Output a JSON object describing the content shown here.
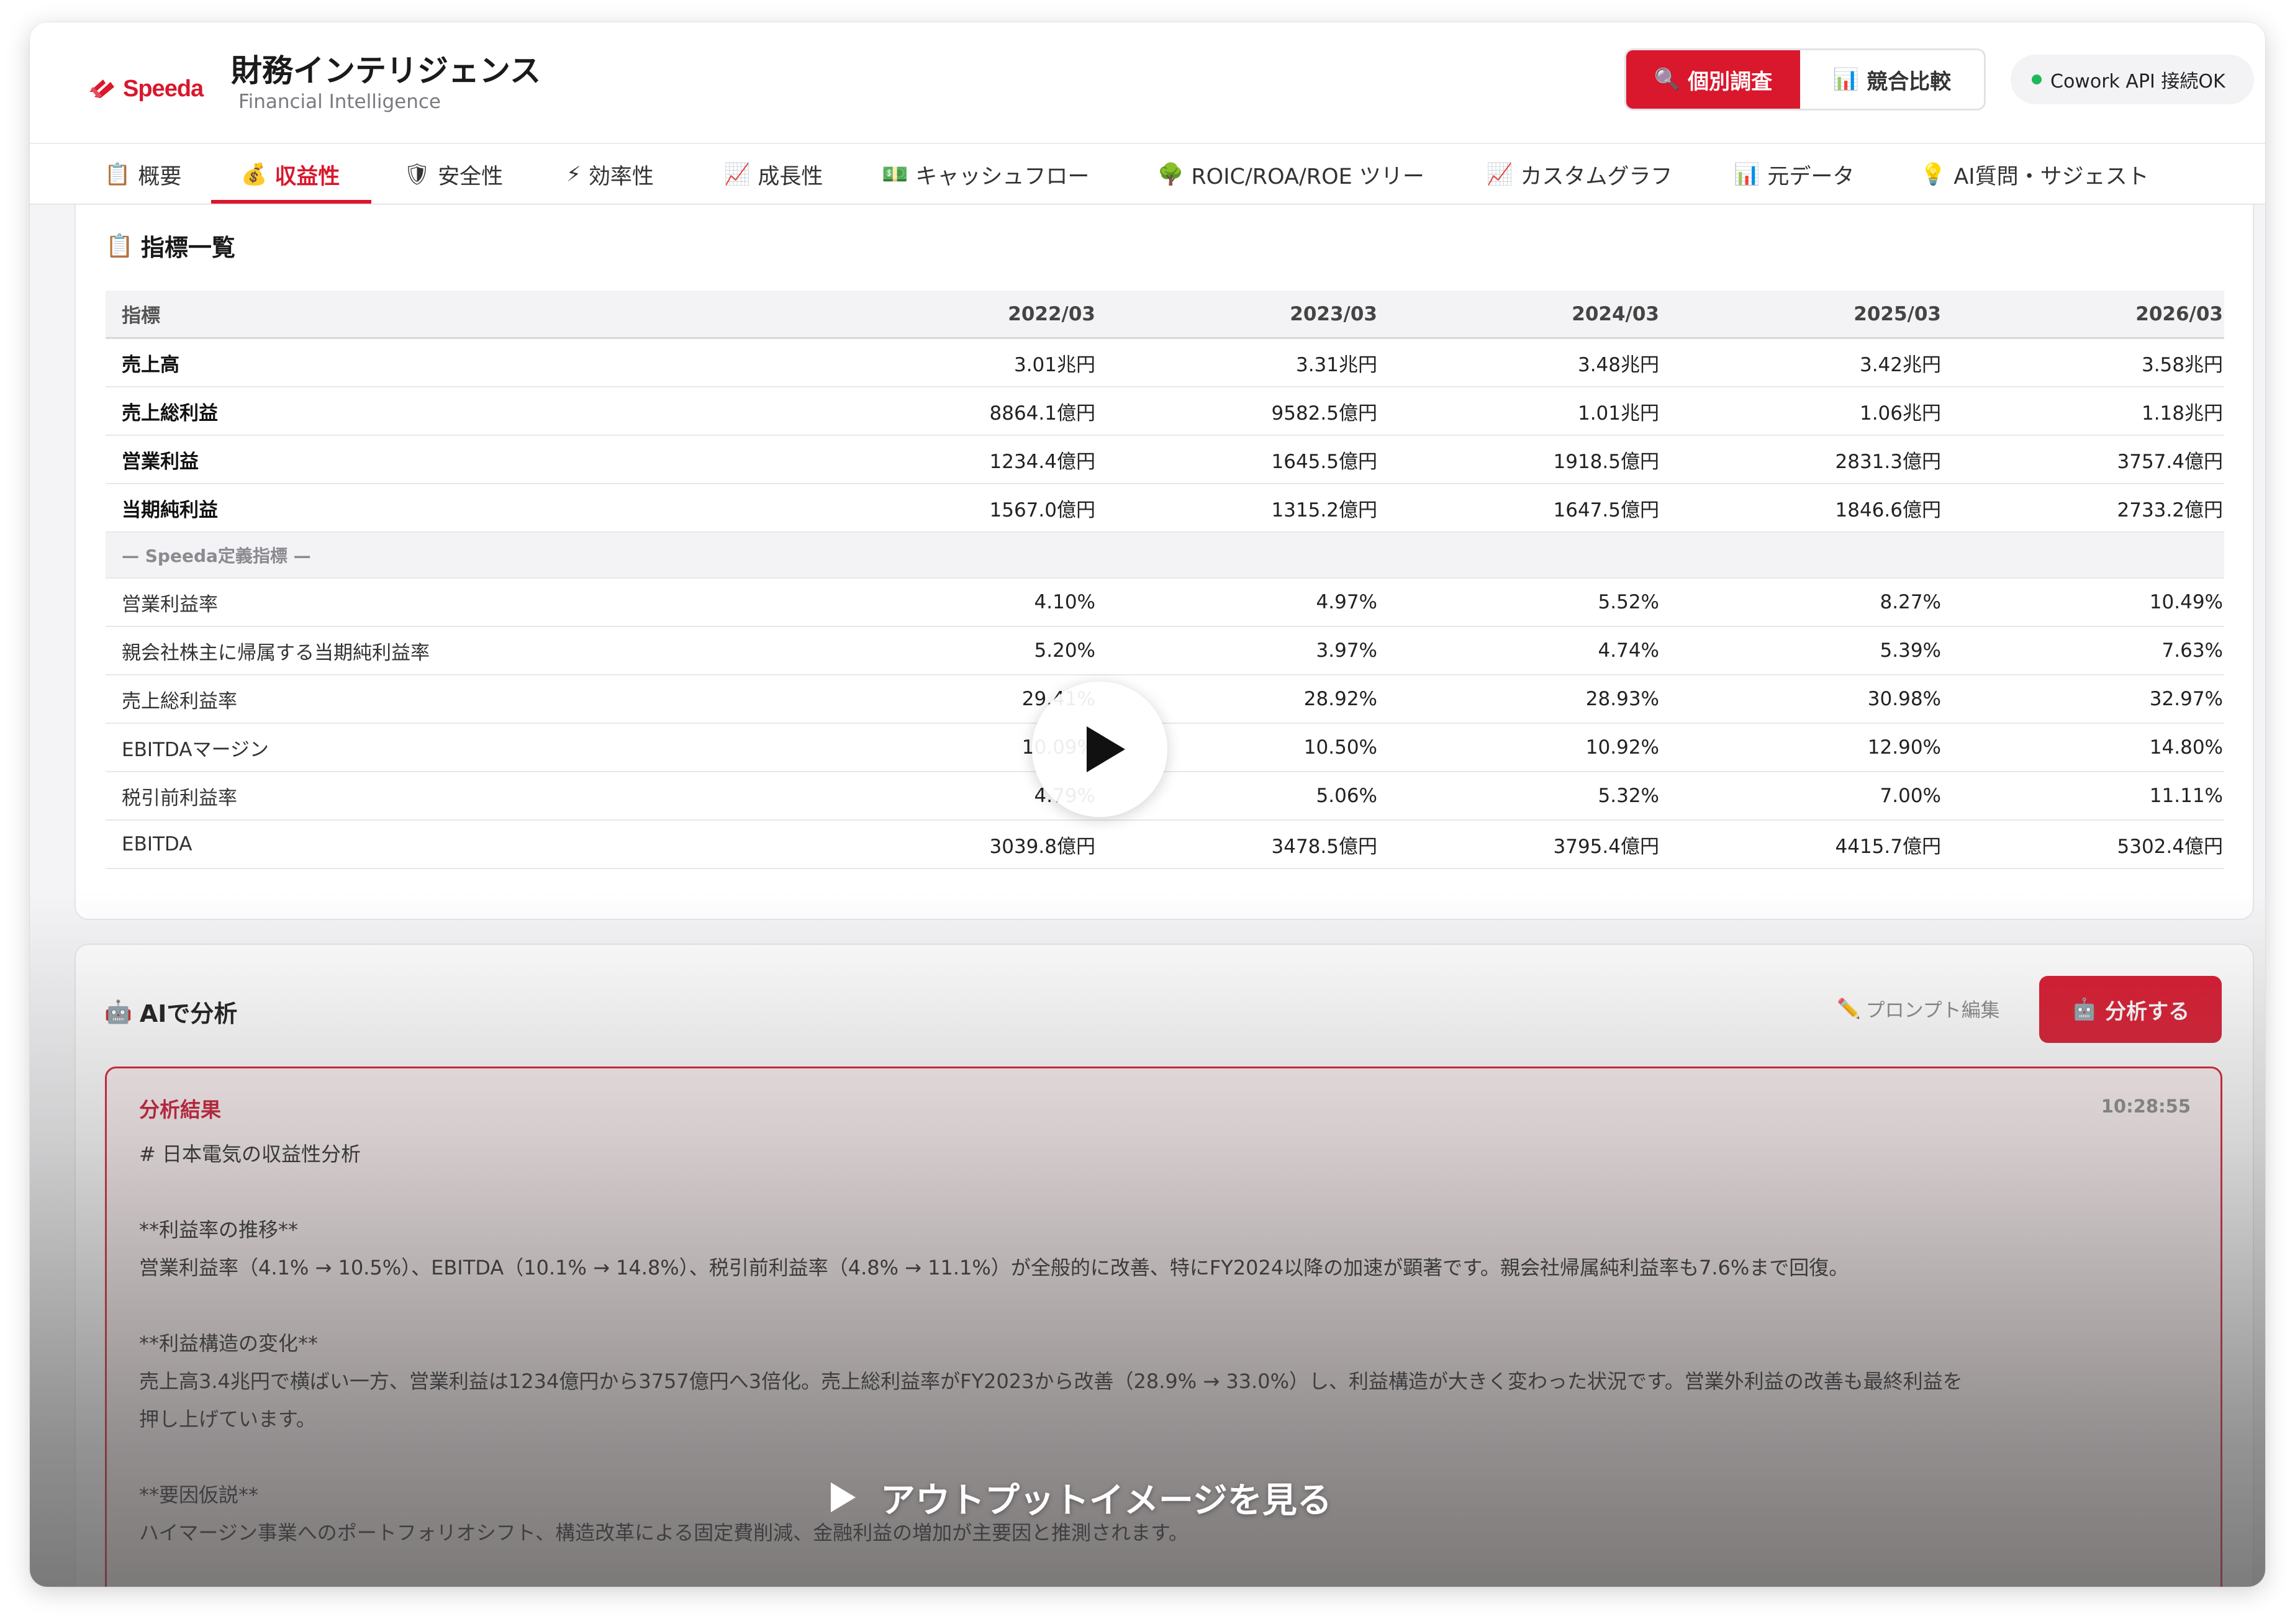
{
  "header": {
    "logo_text": "Speeda",
    "title": "財務インテリジェンス",
    "subtitle": "Financial Intelligence",
    "modes": [
      {
        "label": "個別調査",
        "icon": "search-icon",
        "active": true
      },
      {
        "label": "競合比較",
        "icon": "bar-chart-icon",
        "active": false
      }
    ],
    "status": "Cowork API 接続OK",
    "status_color": "#1fb85a"
  },
  "tabs": [
    {
      "label": "概要",
      "icon": "📋"
    },
    {
      "label": "収益性",
      "icon": "💰",
      "active": true
    },
    {
      "label": "安全性",
      "icon": "🛡"
    },
    {
      "label": "効率性",
      "icon": "⚡"
    },
    {
      "label": "成長性",
      "icon": "📈"
    },
    {
      "label": "キャッシュフロー",
      "icon": "💵"
    },
    {
      "label": "ROIC/ROA/ROE ツリー",
      "icon": "🌳"
    },
    {
      "label": "カスタムグラフ",
      "icon": "📈"
    },
    {
      "label": "元データ",
      "icon": "📊"
    },
    {
      "label": "AI質問・サジェスト",
      "icon": "💡"
    }
  ],
  "metrics": {
    "title": "指標一覧",
    "columns": [
      "指標",
      "2022/03",
      "2023/03",
      "2024/03",
      "2025/03",
      "2026/03"
    ],
    "rows": [
      {
        "label": "売上高",
        "values": [
          "3.01兆円",
          "3.31兆円",
          "3.48兆円",
          "3.42兆円",
          "3.58兆円"
        ],
        "bold": true
      },
      {
        "label": "売上総利益",
        "values": [
          "8864.1億円",
          "9582.5億円",
          "1.01兆円",
          "1.06兆円",
          "1.18兆円"
        ],
        "bold": true
      },
      {
        "label": "営業利益",
        "values": [
          "1234.4億円",
          "1645.5億円",
          "1918.5億円",
          "2831.3億円",
          "3757.4億円"
        ],
        "bold": true
      },
      {
        "label": "当期純利益",
        "values": [
          "1567.0億円",
          "1315.2億円",
          "1647.5億円",
          "1846.6億円",
          "2733.2億円"
        ],
        "bold": true
      },
      {
        "label": "— Speeda定義指標 —",
        "separator": true
      },
      {
        "label": "営業利益率",
        "values": [
          "4.10%",
          "4.97%",
          "5.52%",
          "8.27%",
          "10.49%"
        ]
      },
      {
        "label": "親会社株主に帰属する当期純利益率",
        "values": [
          "5.20%",
          "3.97%",
          "4.74%",
          "5.39%",
          "7.63%"
        ]
      },
      {
        "label": "売上総利益率",
        "values": [
          "29.41%",
          "28.92%",
          "28.93%",
          "30.98%",
          "32.97%"
        ]
      },
      {
        "label": "EBITDAマージン",
        "values": [
          "10.09%",
          "10.50%",
          "10.92%",
          "12.90%",
          "14.80%"
        ]
      },
      {
        "label": "税引前利益率",
        "values": [
          "4.79%",
          "5.06%",
          "5.32%",
          "7.00%",
          "11.11%"
        ]
      },
      {
        "label": "EBITDA",
        "values": [
          "3039.8億円",
          "3478.5億円",
          "3795.4億円",
          "4415.7億円",
          "5302.4億円"
        ]
      }
    ]
  },
  "ai": {
    "title": "AIで分析",
    "prompt_edit": "プロンプト編集",
    "analyze_button": "分析する",
    "result_title": "分析結果",
    "result_time": "10:28:55",
    "result_lines": [
      "# 日本電気の収益性分析",
      "",
      "**利益率の推移**",
      "営業利益率（4.1% → 10.5%）、EBITDA（10.1% → 14.8%）、税引前利益率（4.8% → 11.1%）が全般的に改善、特にFY2024以降の加速が顕著です。親会社帰属純利益率も7.6%まで回復。",
      "",
      "**利益構造の変化**",
      "売上高3.4兆円で横ばい一方、営業利益は1234億円から3757億円へ3倍化。売上総利益率がFY2023から改善（28.9% → 33.0%）し、利益構造が大きく変わった状況です。営業外利益の改善も最終利益を",
      "押し上げています。",
      "",
      "**要因仮説**",
      "ハイマージン事業へのポートフォリオシフト、構造改革による固定費削減、金融利益の増加が主要因と推測されます。"
    ]
  },
  "output_link": "アウトプットイメージを見る",
  "colors": {
    "accent": "#d9172d",
    "result_bg": "#fdf1f2"
  }
}
